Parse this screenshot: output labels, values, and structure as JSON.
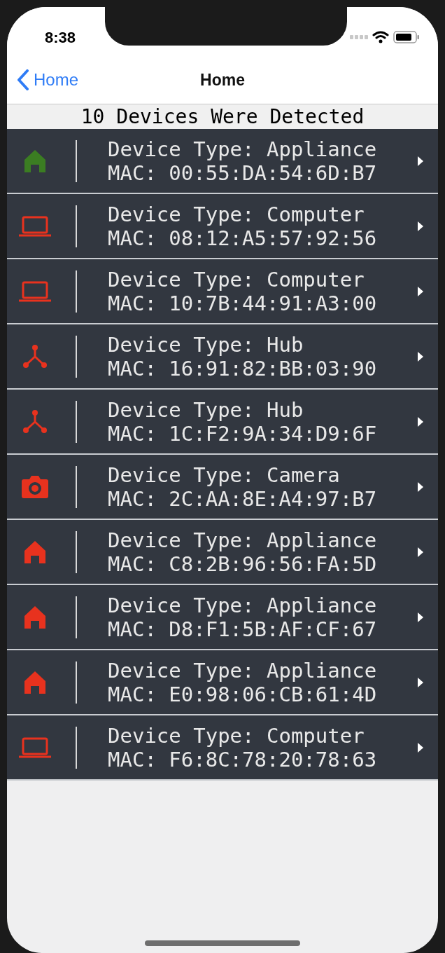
{
  "status_bar": {
    "time": "8:38"
  },
  "nav": {
    "back_label": "Home",
    "title": "Home"
  },
  "header": "10 Devices Were Detected",
  "devices": [
    {
      "kind": "appliance",
      "color": "#3b7d22",
      "type": "Device Type: Appliance",
      "mac": "MAC: 00:55:DA:54:6D:B7"
    },
    {
      "kind": "computer",
      "color": "#e8321e",
      "type": "Device Type: Computer",
      "mac": "MAC: 08:12:A5:57:92:56"
    },
    {
      "kind": "computer",
      "color": "#e8321e",
      "type": "Device Type: Computer",
      "mac": "MAC: 10:7B:44:91:A3:00"
    },
    {
      "kind": "hub",
      "color": "#e8321e",
      "type": "Device Type: Hub",
      "mac": "MAC: 16:91:82:BB:03:90"
    },
    {
      "kind": "hub",
      "color": "#e8321e",
      "type": "Device Type: Hub",
      "mac": "MAC: 1C:F2:9A:34:D9:6F"
    },
    {
      "kind": "camera",
      "color": "#e8321e",
      "type": "Device Type: Camera",
      "mac": "MAC: 2C:AA:8E:A4:97:B7"
    },
    {
      "kind": "appliance",
      "color": "#e8321e",
      "type": "Device Type: Appliance",
      "mac": "MAC: C8:2B:96:56:FA:5D"
    },
    {
      "kind": "appliance",
      "color": "#e8321e",
      "type": "Device Type: Appliance",
      "mac": "MAC: D8:F1:5B:AF:CF:67"
    },
    {
      "kind": "appliance",
      "color": "#e8321e",
      "type": "Device Type: Appliance",
      "mac": "MAC: E0:98:06:CB:61:4D"
    },
    {
      "kind": "computer",
      "color": "#e8321e",
      "type": "Device Type: Computer",
      "mac": "MAC: F6:8C:78:20:78:63"
    }
  ]
}
